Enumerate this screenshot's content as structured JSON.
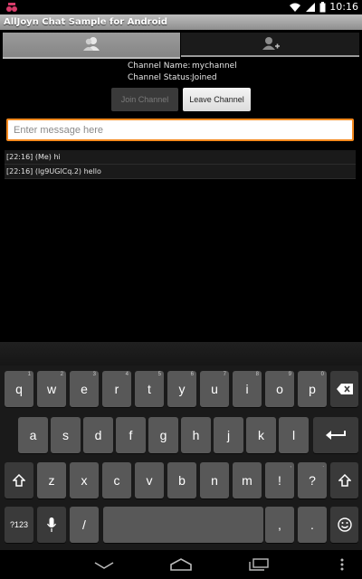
{
  "status_bar": {
    "time": "10:16"
  },
  "title_bar": {
    "title": "AllJoyn Chat Sample for Android"
  },
  "channel": {
    "name_label": "Channel Name:",
    "name_value": "mychannel",
    "status_label": "Channel Status:",
    "status_value": "Joined"
  },
  "buttons": {
    "join": "Join Channel",
    "leave": "Leave Channel"
  },
  "message_input": {
    "placeholder": "Enter message here",
    "value": ""
  },
  "messages": [
    "[22:16] (Me) hi",
    "[22:16] (lg9UGlCq.2) hello"
  ],
  "keyboard": {
    "row1": [
      {
        "main": "q",
        "sub": "1"
      },
      {
        "main": "w",
        "sub": "2"
      },
      {
        "main": "e",
        "sub": "3"
      },
      {
        "main": "r",
        "sub": "4"
      },
      {
        "main": "t",
        "sub": "5"
      },
      {
        "main": "y",
        "sub": "6"
      },
      {
        "main": "u",
        "sub": "7"
      },
      {
        "main": "i",
        "sub": "8"
      },
      {
        "main": "o",
        "sub": "9"
      },
      {
        "main": "p",
        "sub": "0"
      }
    ],
    "row2": [
      "a",
      "s",
      "d",
      "f",
      "g",
      "h",
      "j",
      "k",
      "l"
    ],
    "row3": [
      "z",
      "x",
      "c",
      "v",
      "b",
      "n",
      "m",
      "!",
      "?"
    ],
    "row3_subs": [
      "",
      "",
      "",
      "",
      "",
      "",
      "",
      ",",
      "."
    ],
    "symbols_label": "?123",
    "slash": "/",
    "comma": ",",
    "period": "."
  },
  "colors": {
    "accent_orange": "#f58a1f",
    "key_gray": "#585858",
    "title_bar": "#9e9e9e"
  },
  "icons": {
    "status_app": "alljoyn-icon",
    "status_wifi": "wifi-icon",
    "status_signal": "signal-icon",
    "status_battery": "battery-icon",
    "tab_1": "contacts-icon",
    "tab_2": "add-contact-icon",
    "backspace": "backspace-icon",
    "enter": "enter-icon",
    "shift": "shift-icon",
    "mic": "mic-icon",
    "emoji": "smiley-icon",
    "nav_back": "back-icon",
    "nav_home": "home-icon",
    "nav_recents": "recents-icon",
    "nav_menu": "overflow-menu-icon"
  }
}
